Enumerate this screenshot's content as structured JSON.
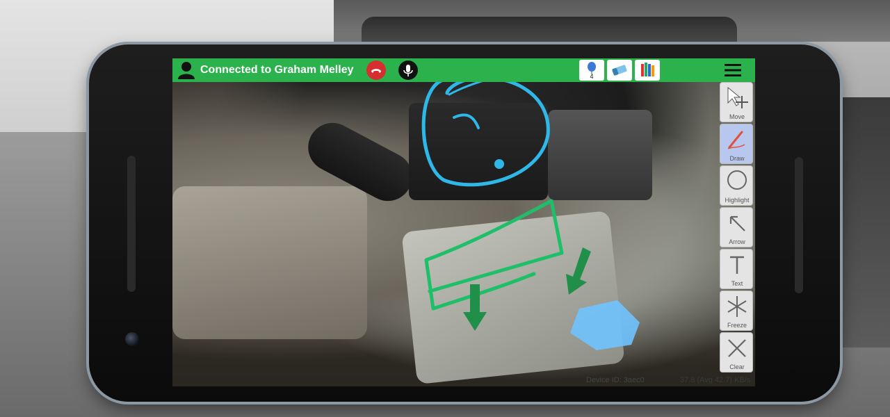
{
  "topbar": {
    "connection_text": "Connected to Graham Melley",
    "balloon_count": "4"
  },
  "toolbar": {
    "items": [
      {
        "label": "Move",
        "icon": "move-cursor-icon"
      },
      {
        "label": "Draw",
        "icon": "pen-icon"
      },
      {
        "label": "Highlight",
        "icon": "circle-icon"
      },
      {
        "label": "Arrow",
        "icon": "arrow-icon"
      },
      {
        "label": "Text",
        "icon": "text-t-icon"
      },
      {
        "label": "Freeze",
        "icon": "snowflake-icon"
      },
      {
        "label": "Clear",
        "icon": "x-icon"
      }
    ],
    "active": "Draw"
  },
  "status": {
    "device_id": "Device ID: 3aec0",
    "rate": "37.8 (Avg 42.7) KB/s"
  },
  "colors": {
    "topbar": "#2bb24c",
    "hangup": "#d62f2f",
    "annotation_blue": "#2fb7e8",
    "annotation_green": "#1fbf6a",
    "arrow_green": "#1f8f4a",
    "highlight_blue": "#6fc3ff"
  }
}
